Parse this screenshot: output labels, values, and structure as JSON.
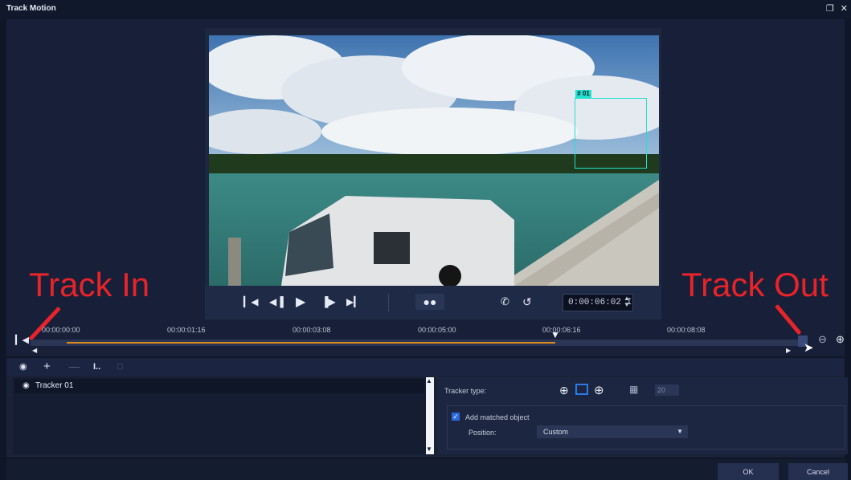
{
  "window": {
    "title": "Track Motion",
    "restore_icon": "restore-icon",
    "close_icon": "close-icon"
  },
  "video": {
    "tracker_tag": "# 01"
  },
  "playback": {
    "timecode": "0:00:06:02 I",
    "buttons": [
      "go-to-start",
      "previous-frame",
      "play",
      "next-frame",
      "go-to-end",
      "track-motion",
      "phone-icon",
      "history-icon"
    ]
  },
  "annotations": {
    "track_in": "Track In",
    "track_out": "Track Out"
  },
  "timeline": {
    "ticks": [
      "00:00:00:00",
      "00:00:01:16",
      "00:00:03:08",
      "00:00:05:00",
      "00:00:06:16",
      "00:00:08:08"
    ]
  },
  "toolbar": {
    "items": [
      "tracker-icon",
      "add-icon",
      "remove-icon",
      "rename-icon",
      "export-icon"
    ]
  },
  "tracker_list": {
    "items": [
      {
        "label": "Tracker 01"
      }
    ]
  },
  "settings": {
    "tracker_type_label": "Tracker type:",
    "size_value": "20",
    "add_matched_object_label": "Add matched object",
    "add_matched_object_checked": true,
    "position_label": "Position:",
    "position_value": "Custom"
  },
  "footer": {
    "ok_label": "OK",
    "cancel_label": "Cancel"
  },
  "colors": {
    "accent": "#e08a1e",
    "tracker": "#23e0d0",
    "annotation": "#e8232a",
    "background": "#0f1628"
  }
}
